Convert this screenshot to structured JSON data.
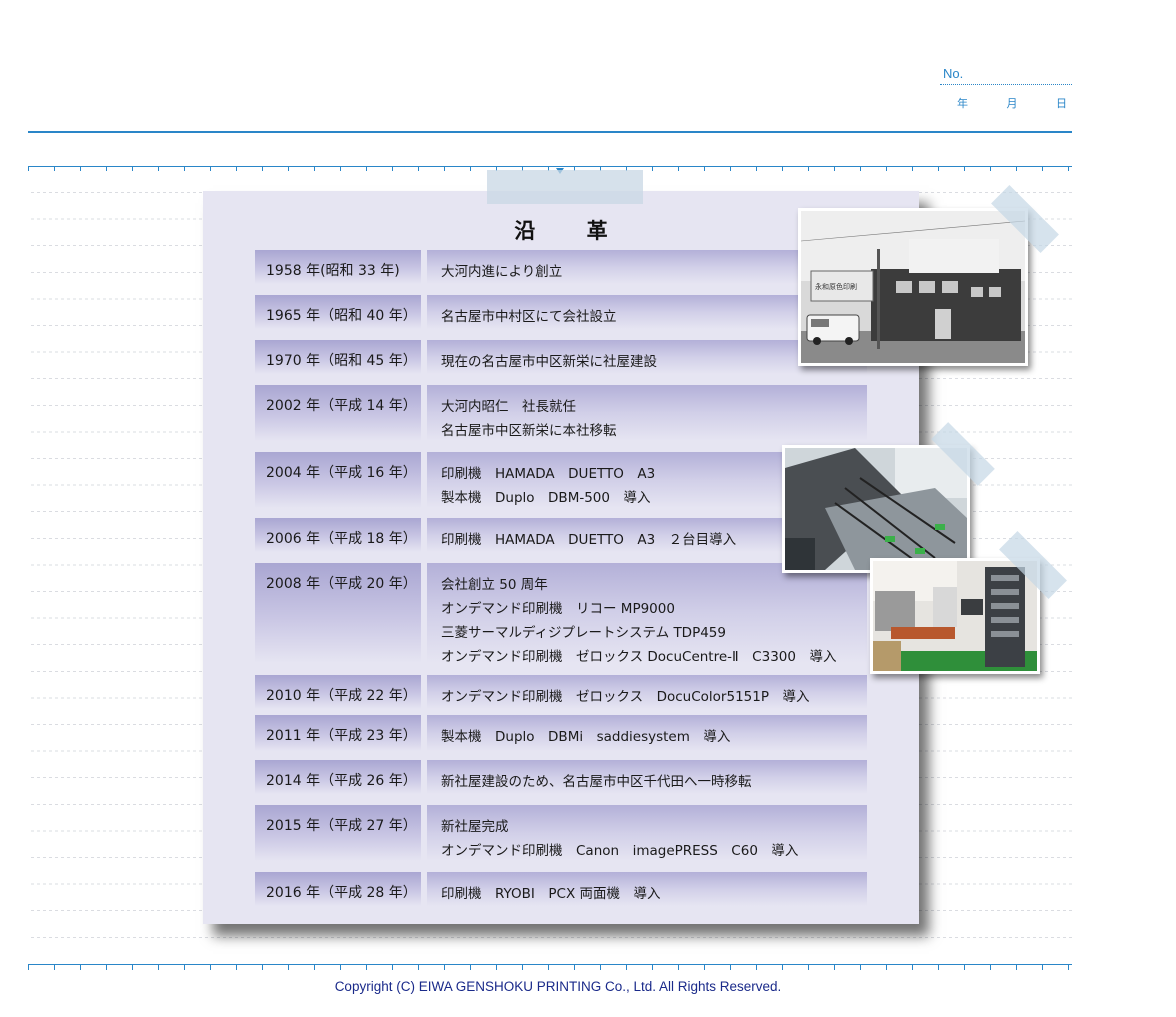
{
  "header": {
    "no_label": "No.",
    "date_labels": [
      "年",
      "月",
      "日"
    ]
  },
  "card": {
    "title": "沿 革",
    "rows": [
      {
        "year": "1958 年(昭和 33 年)",
        "lines": [
          "大河内進により創立"
        ]
      },
      {
        "year": "1965 年（昭和 40 年）",
        "lines": [
          "名古屋市中村区にて会社設立"
        ]
      },
      {
        "year": "1970 年（昭和 45 年）",
        "lines": [
          "現在の名古屋市中区新栄に社屋建設"
        ]
      },
      {
        "year": "2002 年（平成 14 年）",
        "lines": [
          "大河内昭仁　社長就任",
          "名古屋市中区新栄に本社移転"
        ]
      },
      {
        "year": "2004 年（平成 16 年）",
        "lines": [
          "印刷機　HAMADA　DUETTO　A3",
          "製本機　Duplo　DBM-500　導入"
        ]
      },
      {
        "year": "2006 年（平成 18 年）",
        "lines": [
          "印刷機　HAMADA　DUETTO　A3　２台目導入"
        ]
      },
      {
        "year": "2008 年（平成 20 年）",
        "lines": [
          "会社創立 50 周年",
          "オンデマンド印刷機　リコー MP9000",
          "三菱サーマルディジプレートシステム TDP459",
          "オンデマンド印刷機　ゼロックス DocuCentre-Ⅱ　C3300　導入"
        ]
      },
      {
        "year": "2010 年（平成 22 年）",
        "lines": [
          "オンデマンド印刷機　ゼロックス　DocuColor5151P　導入"
        ]
      },
      {
        "year": "2011 年（平成 23 年）",
        "lines": [
          "製本機　Duplo　DBMi　saddiesystem　導入"
        ]
      },
      {
        "year": "2014 年（平成 26 年）",
        "lines": [
          "新社屋建設のため、名古屋市中区千代田へ一時移転"
        ]
      },
      {
        "year": "2015 年（平成 27 年）",
        "lines": [
          "新社屋完成",
          "オンデマンド印刷機　Canon　imagePRESS　C60　導入"
        ]
      },
      {
        "year": "2016 年（平成 28 年）",
        "lines": [
          "印刷機　RYOBI　PCX 両面機　導入"
        ]
      }
    ]
  },
  "photos": {
    "building_sign": "永和原色印刷"
  },
  "footer": {
    "copyright": "Copyright (C) EIWA GENSHOKU PRINTING Co., Ltd. All Rights Reserved."
  }
}
